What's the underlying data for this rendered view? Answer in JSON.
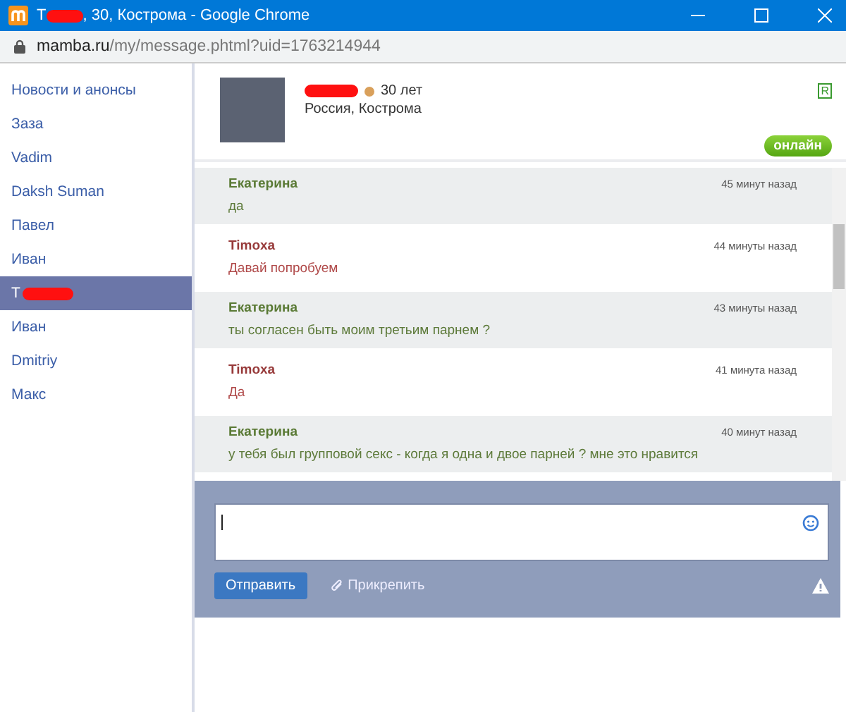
{
  "window": {
    "title_start": "T",
    "title_end": ", 30, Кострома - Google Chrome"
  },
  "address_bar": {
    "domain": "mamba.ru",
    "path": "/my/message.phtml?uid=1763214944"
  },
  "sidebar": {
    "items": [
      {
        "label": "Новости и анонсы",
        "selected": false,
        "redacted": false
      },
      {
        "label": "Заза",
        "selected": false,
        "redacted": false
      },
      {
        "label": "Vadim",
        "selected": false,
        "redacted": false
      },
      {
        "label": "Daksh Suman",
        "selected": false,
        "redacted": false
      },
      {
        "label": "Павел",
        "selected": false,
        "redacted": false
      },
      {
        "label": "Иван",
        "selected": false,
        "redacted": false
      },
      {
        "label": "T",
        "selected": true,
        "redacted": true
      },
      {
        "label": "Иван",
        "selected": false,
        "redacted": false
      },
      {
        "label": "Dmitriy",
        "selected": false,
        "redacted": false
      },
      {
        "label": "Макс",
        "selected": false,
        "redacted": false
      }
    ]
  },
  "profile": {
    "age": "30 лет",
    "location": "Россия, Кострома",
    "badge": "R",
    "status": "онлайн"
  },
  "messages": [
    {
      "kind": "them",
      "author": "Екатерина",
      "time": "45 минут назад",
      "text": "да"
    },
    {
      "kind": "me",
      "author": "Timoxa",
      "time": "44 минуты назад",
      "text": "Давай попробуем"
    },
    {
      "kind": "them",
      "author": "Екатерина",
      "time": "43 минуты назад",
      "text": "ты согласен быть моим третьим парнем ?"
    },
    {
      "kind": "me",
      "author": "Timoxa",
      "time": "41 минута назад",
      "text": "Да"
    },
    {
      "kind": "them",
      "author": "Екатерина",
      "time": "40 минут назад",
      "text": "у тебя был групповой секс - когда я одна и двое парней ? мне это нравится"
    }
  ],
  "compose": {
    "send": "Отправить",
    "attach": "Прикрепить"
  }
}
